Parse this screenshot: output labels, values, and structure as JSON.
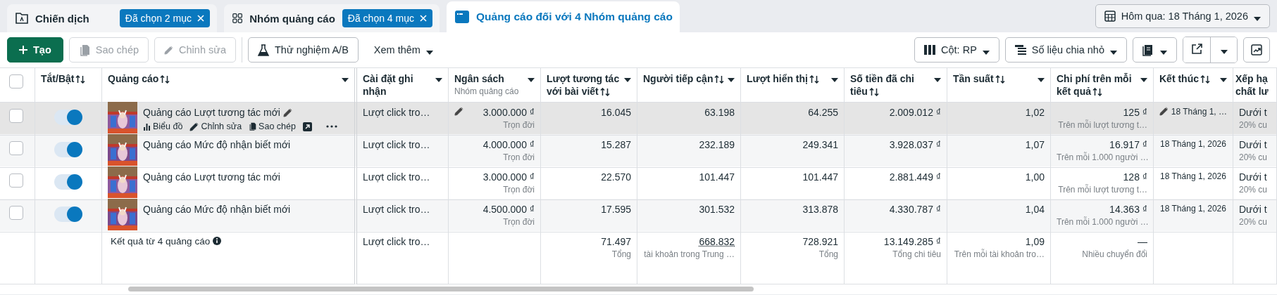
{
  "tabs": [
    {
      "label": "Chiến dịch",
      "kind": "campaign",
      "selected": false,
      "chip": "Đã chọn 2 mục"
    },
    {
      "label": "Nhóm quảng cáo",
      "kind": "adset",
      "selected": false,
      "chip": "Đã chọn 4 mục"
    },
    {
      "label": "Quảng cáo đối với 4 Nhóm quảng cáo",
      "kind": "ad",
      "selected": true
    }
  ],
  "date_button": {
    "label": "Hôm qua: 18 Tháng 1, 2026"
  },
  "toolbar": {
    "left": [
      {
        "label": "Tạo",
        "kind": "create",
        "disabled": false
      },
      {
        "label": "Sao chép",
        "kind": "copy",
        "disabled": true
      },
      {
        "label": "Chỉnh sửa",
        "kind": "edit",
        "disabled": true
      },
      {
        "label": "Thử nghiệm A/B",
        "kind": "abtest",
        "disabled": false
      },
      {
        "label": "Xem thêm",
        "kind": "more",
        "disabled": false
      }
    ],
    "right": [
      {
        "label": "Cột: RP",
        "kind": "columns"
      },
      {
        "label": "Số liệu chia nhỏ",
        "kind": "breakdown"
      },
      {
        "kind": "reports"
      },
      {
        "kind": "export"
      },
      {
        "kind": "chart"
      }
    ]
  },
  "table": {
    "all_checked": false,
    "columns": [
      {
        "title": "Tắt/Bật",
        "sortable": true,
        "menu": false
      },
      {
        "title": "Quảng cáo",
        "sortable": true,
        "menu": true
      },
      {
        "title": "Cài đặt ghi nhận",
        "sortable": false,
        "menu": true
      },
      {
        "title": "Ngân sách",
        "subtitle": "Nhóm quảng cáo",
        "sortable": false,
        "menu": true
      },
      {
        "title": "Lượt tương tác với bài viết",
        "sortable": true,
        "menu": true
      },
      {
        "title": "Người tiếp cận",
        "sortable": true,
        "menu": true
      },
      {
        "title": "Lượt hiển thị",
        "sortable": true,
        "menu": true
      },
      {
        "title": "Số tiền đã chi tiêu",
        "sortable": true,
        "menu": true
      },
      {
        "title": "Tần suất",
        "sortable": true,
        "menu": true
      },
      {
        "title": "Chi phí trên mỗi kết quả",
        "sortable": true,
        "menu": true
      },
      {
        "title": "Kết thúc",
        "sortable": true,
        "menu": true
      },
      {
        "title": "Xếp hạ chất lư",
        "sortable": false,
        "menu": false
      }
    ],
    "rows": [
      {
        "checked": false,
        "on": true,
        "hovered": true,
        "name": "Quảng cáo Lượt tương tác mới",
        "actions": [
          "Biểu đồ",
          "Chỉnh sửa",
          "Sao chép"
        ],
        "setting": "Lượt click tro…",
        "budget": "3.000.000 ₫",
        "budget_note": "Trọn đời",
        "engagement": "16.045",
        "reach": "63.198",
        "impressions": "64.255",
        "spent": "2.009.012 ₫",
        "frequency": "1,02",
        "cost": "125 ₫",
        "cost_note": "Trên mỗi lượt tương t…",
        "end": "18 Tháng 1, …",
        "quality": "Dưới t",
        "quality_note": "20% cu"
      },
      {
        "checked": false,
        "on": true,
        "hovered": false,
        "name": "Quảng cáo Mức độ nhận biết mới",
        "setting": "Lượt click tro…",
        "budget": "4.000.000 ₫",
        "budget_note": "Trọn đời",
        "engagement": "15.287",
        "reach": "232.189",
        "impressions": "249.341",
        "spent": "3.928.037 ₫",
        "frequency": "1,07",
        "cost": "16.917 ₫",
        "cost_note": "Trên mỗi 1.000 người …",
        "end": "18 Tháng 1, 2026",
        "quality": "Dưới t",
        "quality_note": "20% cu"
      },
      {
        "checked": false,
        "on": true,
        "hovered": false,
        "name": "Quảng cáo Lượt tương tác mới",
        "setting": "Lượt click tro…",
        "budget": "3.000.000 ₫",
        "budget_note": "Trọn đời",
        "engagement": "22.570",
        "reach": "101.447",
        "impressions": "101.447",
        "spent": "2.881.449 ₫",
        "frequency": "1,00",
        "cost": "128 ₫",
        "cost_note": "Trên mỗi lượt tương t…",
        "end": "18 Tháng 1, 2026",
        "quality": "Dưới t",
        "quality_note": "20% cu"
      },
      {
        "checked": false,
        "on": true,
        "hovered": false,
        "name": "Quảng cáo Mức độ nhận biết mới",
        "setting": "Lượt click tro…",
        "budget": "4.500.000 ₫",
        "budget_note": "Trọn đời",
        "engagement": "17.595",
        "reach": "301.532",
        "impressions": "313.878",
        "spent": "4.330.787 ₫",
        "frequency": "1,04",
        "cost": "14.363 ₫",
        "cost_note": "Trên mỗi 1.000 người …",
        "end": "18 Tháng 1, 2026",
        "quality": "Dưới t",
        "quality_note": "20% cu"
      }
    ],
    "footer": {
      "label": "Kết quả từ 4 quảng cáo",
      "setting": "Lượt click tro…",
      "cells": [
        {
          "value": "71.497",
          "note": "Tổng"
        },
        {
          "value": "668.832",
          "note": "tài khoản trong Trung …",
          "dotted": true
        },
        {
          "value": "728.921",
          "note": "Tổng"
        },
        {
          "value": "13.149.285 ₫",
          "note": "Tổng chi tiêu"
        },
        {
          "value": "1,09",
          "note": "Trên mỗi tài khoản tro…"
        },
        {
          "value": "—",
          "note": "Nhiều chuyển đổi"
        }
      ]
    }
  }
}
